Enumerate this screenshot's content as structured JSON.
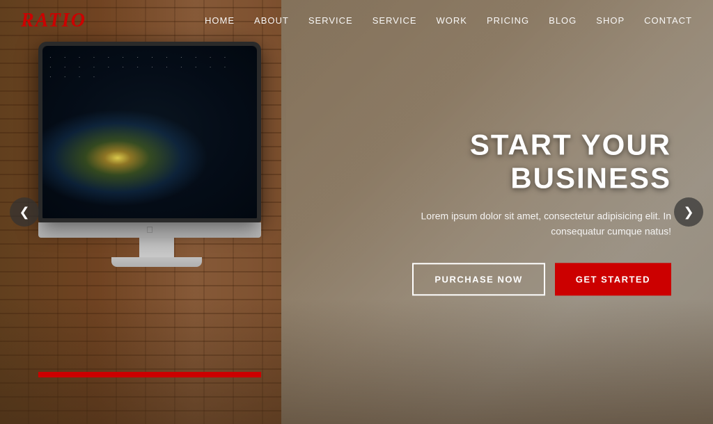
{
  "logo": {
    "text": "RATIO"
  },
  "nav": {
    "items": [
      {
        "label": "HOME",
        "href": "#"
      },
      {
        "label": "ABOUT",
        "href": "#"
      },
      {
        "label": "SERVICE",
        "href": "#"
      },
      {
        "label": "SERVICE",
        "href": "#"
      },
      {
        "label": "WORK",
        "href": "#"
      },
      {
        "label": "PRICING",
        "href": "#"
      },
      {
        "label": "BLOG",
        "href": "#"
      },
      {
        "label": "SHOP",
        "href": "#"
      },
      {
        "label": "CONTACT",
        "href": "#"
      }
    ]
  },
  "hero": {
    "title": "START YOUR BUSINESS",
    "subtitle": "Lorem ipsum dolor sit amet, consectetur adipisicing elit. In consequatur cumque natus!",
    "btn_outline": "PURCHASE NOW",
    "btn_red": "GET STARTED"
  },
  "arrows": {
    "left": "❮",
    "right": "❯"
  }
}
